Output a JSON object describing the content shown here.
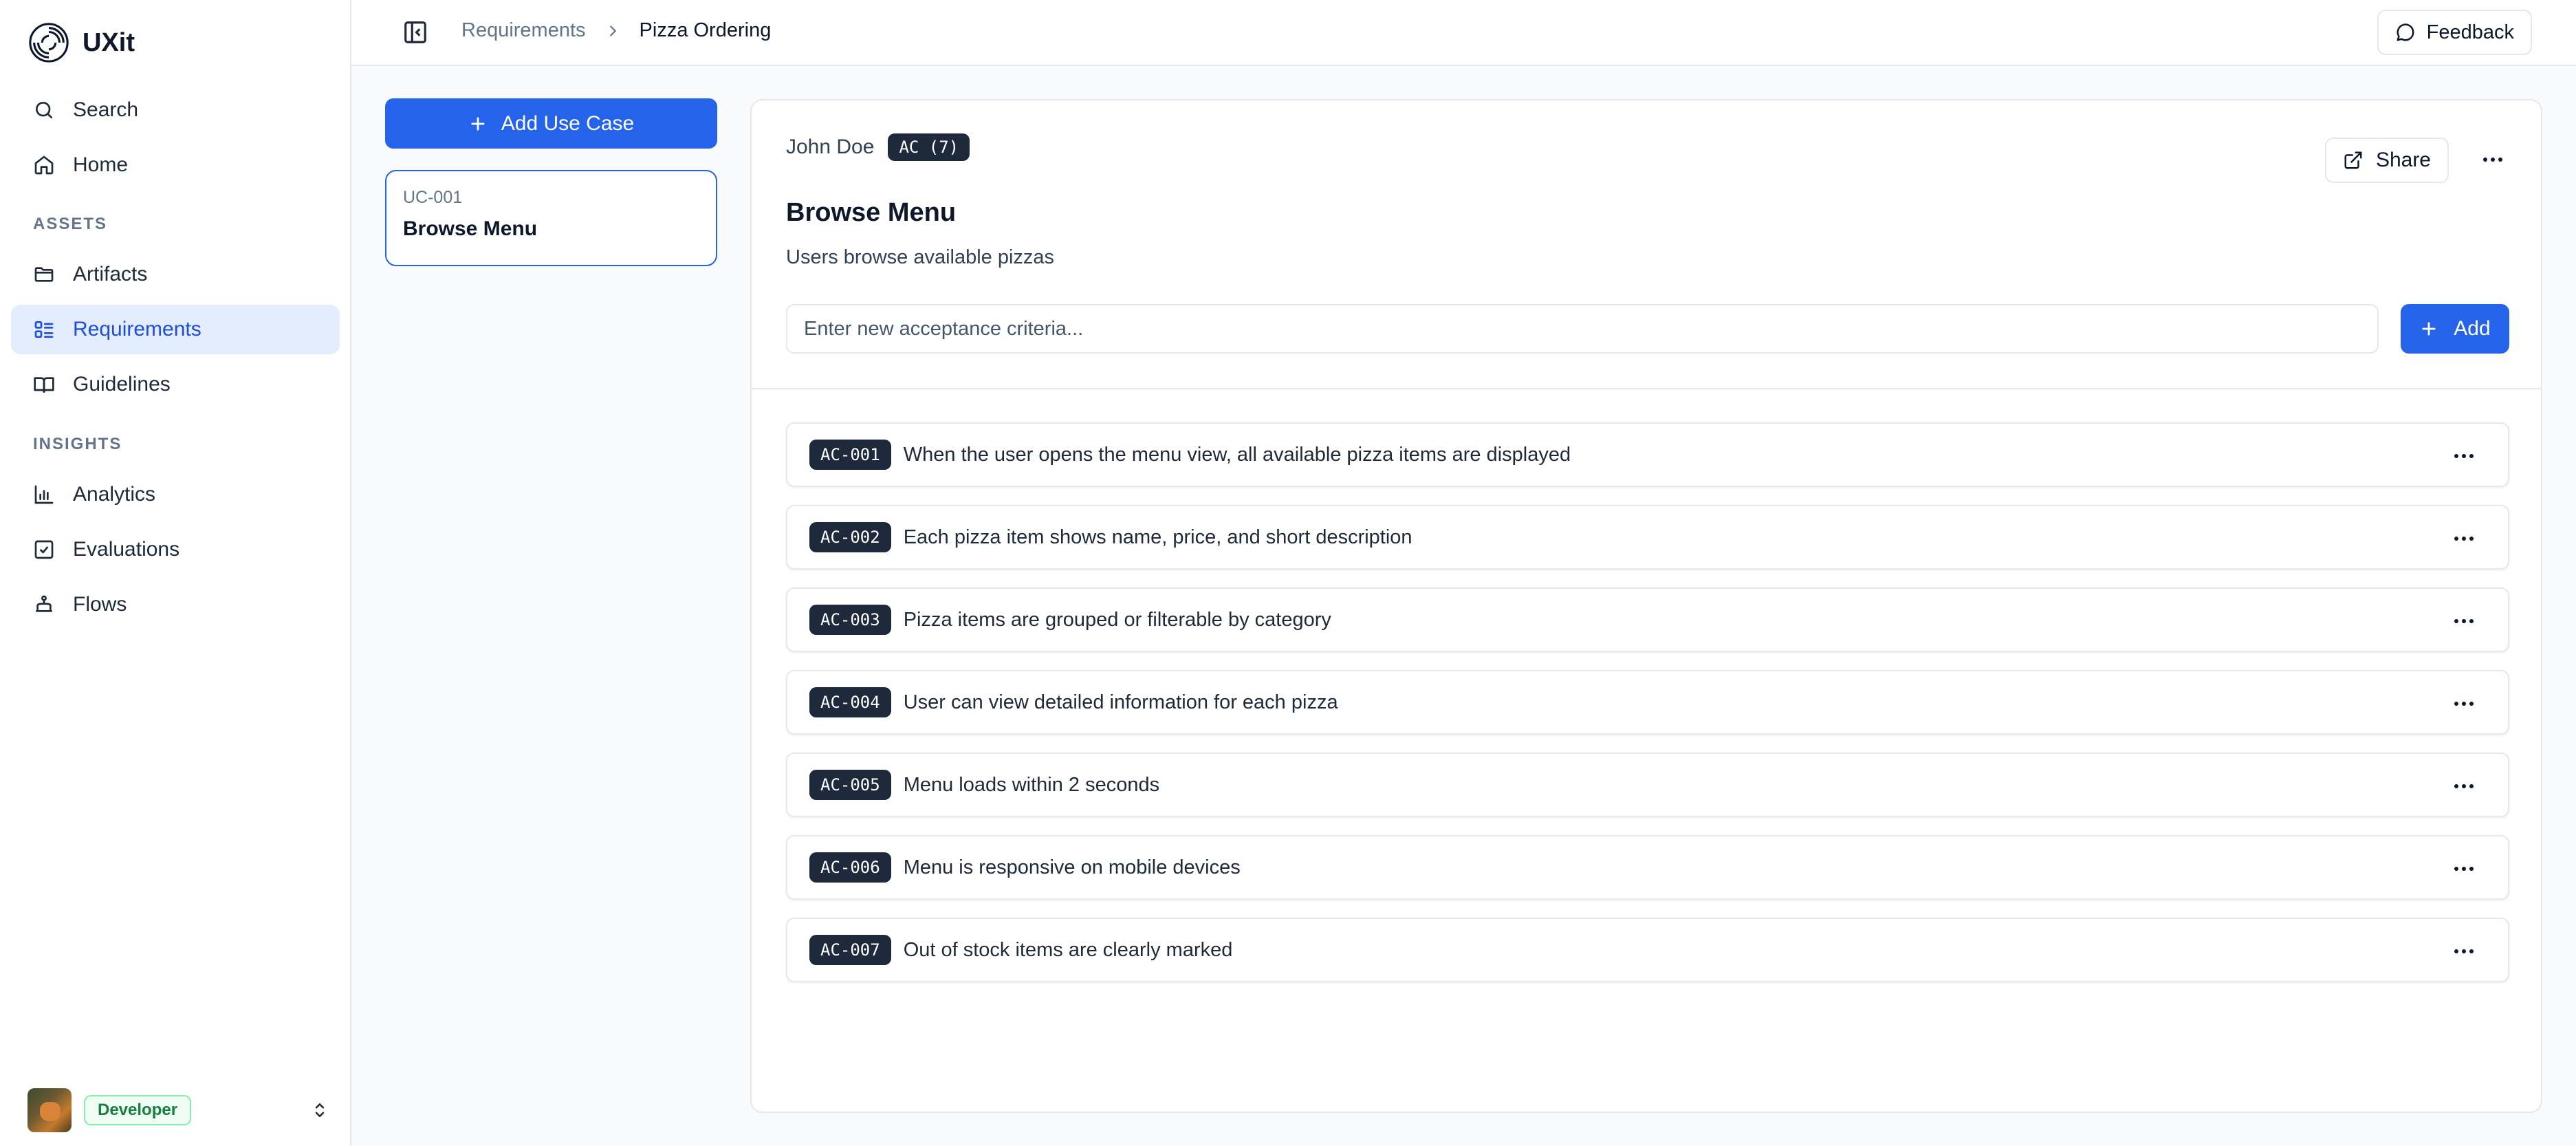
{
  "app": {
    "name": "UXit"
  },
  "sidebar": {
    "top_items": [
      {
        "label": "Search",
        "icon": "search-icon"
      },
      {
        "label": "Home",
        "icon": "home-icon"
      }
    ],
    "assets_label": "ASSETS",
    "assets_items": [
      {
        "label": "Artifacts",
        "icon": "folder-icon"
      },
      {
        "label": "Requirements",
        "icon": "list-icon",
        "active": true
      },
      {
        "label": "Guidelines",
        "icon": "book-icon"
      }
    ],
    "insights_label": "INSIGHTS",
    "insights_items": [
      {
        "label": "Analytics",
        "icon": "bar-chart-icon"
      },
      {
        "label": "Evaluations",
        "icon": "check-square-icon"
      },
      {
        "label": "Flows",
        "icon": "workflow-icon"
      }
    ],
    "user": {
      "role": "Developer"
    }
  },
  "header": {
    "breadcrumb": {
      "parent": "Requirements",
      "current": "Pizza Ordering"
    },
    "feedback_label": "Feedback"
  },
  "usecases": {
    "add_label": "Add Use Case",
    "items": [
      {
        "id": "UC-001",
        "title": "Browse Menu",
        "selected": true
      }
    ]
  },
  "detail": {
    "author": "John Doe",
    "ac_badge": "AC (7)",
    "share_label": "Share",
    "title": "Browse Menu",
    "description": "Users browse available pizzas",
    "input_placeholder": "Enter new acceptance criteria...",
    "add_label": "Add",
    "criteria": [
      {
        "id": "AC-001",
        "text": "When the user opens the menu view, all available pizza items are displayed"
      },
      {
        "id": "AC-002",
        "text": "Each pizza item shows name, price, and short description"
      },
      {
        "id": "AC-003",
        "text": "Pizza items are grouped or filterable by category"
      },
      {
        "id": "AC-004",
        "text": "User can view detailed information for each pizza"
      },
      {
        "id": "AC-005",
        "text": "Menu loads within 2 seconds"
      },
      {
        "id": "AC-006",
        "text": "Menu is responsive on mobile devices"
      },
      {
        "id": "AC-007",
        "text": "Out of stock items are clearly marked"
      }
    ]
  },
  "colors": {
    "accent": "#2563eb",
    "active_bg": "#e3edfd",
    "badge_dark": "#1e293b",
    "role_green": "#15803d"
  }
}
